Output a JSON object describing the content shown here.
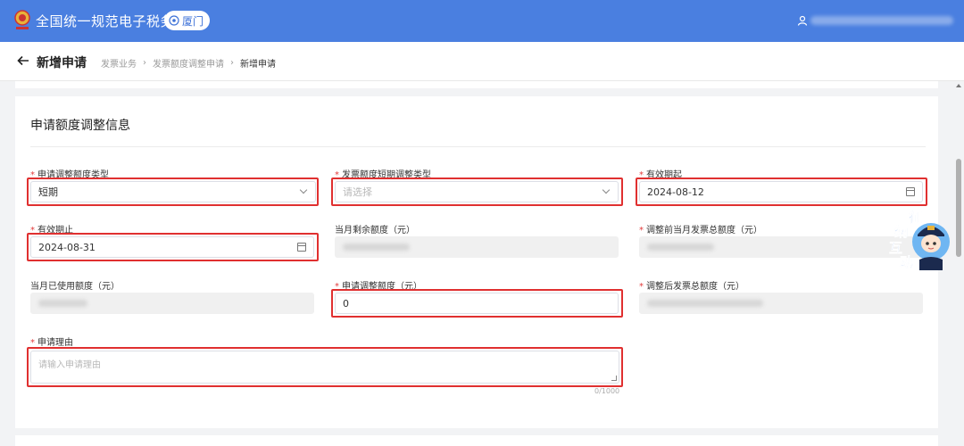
{
  "header": {
    "app_title": "全国统一规范电子税务局",
    "city": "厦门",
    "brand_color": "#4a7fe0"
  },
  "nav": {
    "page_title": "新增申请",
    "breadcrumbs": [
      "发票业务",
      "发票额度调整申请",
      "新增申请"
    ]
  },
  "section": {
    "title": "申请额度调整信息"
  },
  "form": {
    "adjust_type": {
      "label": "申请调整额度类型",
      "required": true,
      "value": "短期"
    },
    "short_adjust_type": {
      "label": "发票额度短期调整类型",
      "required": true,
      "placeholder": "请选择"
    },
    "valid_from": {
      "label": "有效期起",
      "required": true,
      "value": "2024-08-12"
    },
    "valid_to": {
      "label": "有效期止",
      "required": true,
      "value": "2024-08-31"
    },
    "month_remaining": {
      "label": "当月剩余额度（元）",
      "required": false
    },
    "before_total": {
      "label": "调整前当月发票总额度（元）",
      "required": true
    },
    "month_used": {
      "label": "当月已使用额度（元）",
      "required": false
    },
    "apply_amount": {
      "label": "申请调整额度（元）",
      "required": true,
      "value": "0"
    },
    "after_total": {
      "label": "调整后发票总额度（元）",
      "required": true
    },
    "reason": {
      "label": "申请理由",
      "required": true,
      "placeholder": "请输入申请理由",
      "counter": "0/1000"
    }
  },
  "req_mark": "*",
  "mascot": {
    "chars": [
      "征",
      "纳",
      "互",
      "动"
    ]
  },
  "highlight_color": "#e03030"
}
